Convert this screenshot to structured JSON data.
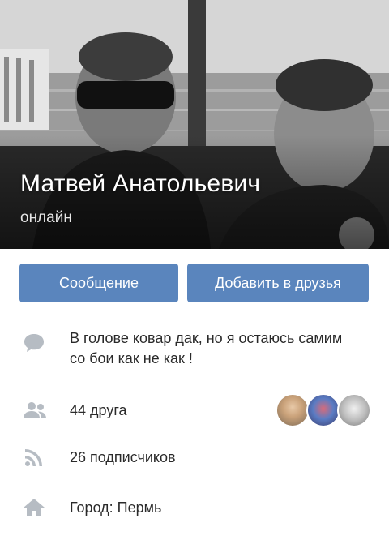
{
  "profile": {
    "name": "Матвей Анатольевич",
    "status": "онлайн"
  },
  "actions": {
    "message_label": "Сообщение",
    "add_friend_label": "Добавить в друзья",
    "accent": "#5a85bd"
  },
  "info": {
    "status_text": "В голове ковар дак, но я остаюсь самим со бои как не как !",
    "friends_label": "44 друга",
    "followers_label": "26 подписчиков",
    "city_label": "Город: Пермь"
  },
  "icons": {
    "status": "speech-bubble-icon",
    "friends": "people-icon",
    "followers": "rss-feed-icon",
    "city": "home-icon"
  }
}
